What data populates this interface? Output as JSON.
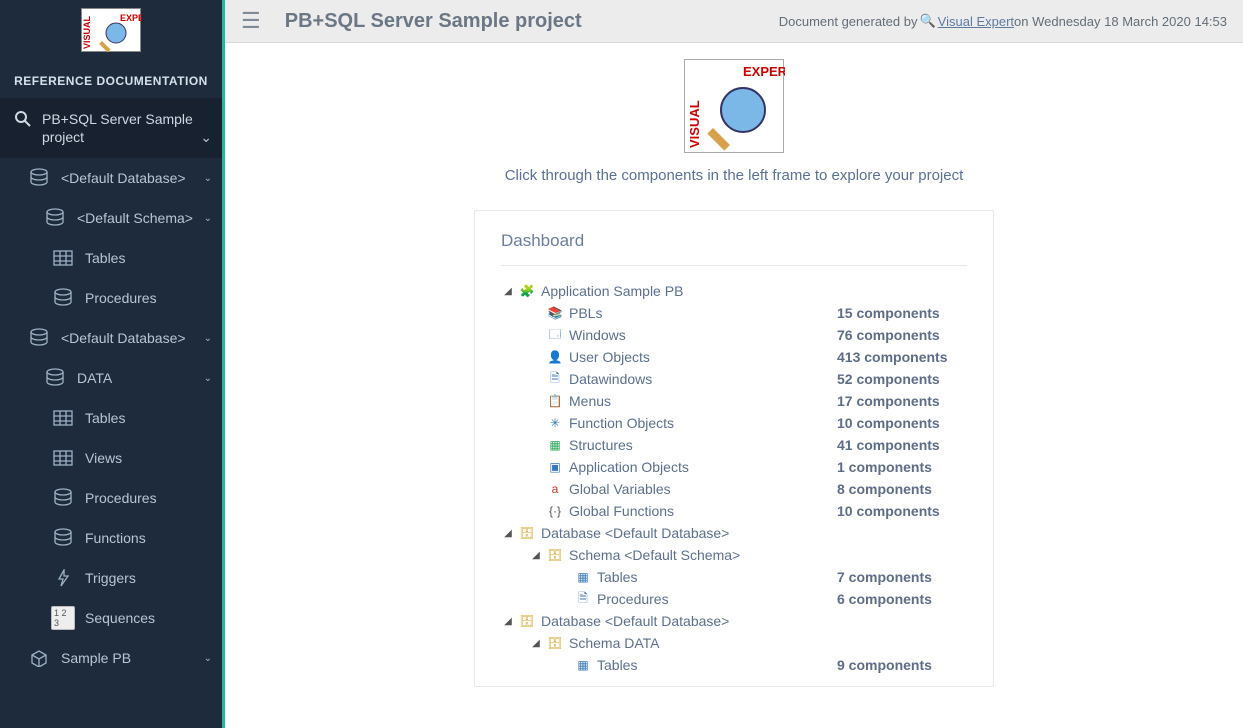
{
  "sidebar": {
    "title": "REFERENCE DOCUMENTATION",
    "project_label": "PB+SQL Server Sample project",
    "items": [
      {
        "label": "<Default Database>",
        "indent": 1,
        "icon": "db",
        "expandable": true
      },
      {
        "label": "<Default Schema>",
        "indent": 2,
        "icon": "db",
        "expandable": true
      },
      {
        "label": "Tables",
        "indent": 3,
        "icon": "table",
        "expandable": false
      },
      {
        "label": "Procedures",
        "indent": 3,
        "icon": "db",
        "expandable": false
      },
      {
        "label": "<Default Database>",
        "indent": 1,
        "icon": "db",
        "expandable": true
      },
      {
        "label": "DATA",
        "indent": 2,
        "icon": "db",
        "expandable": true
      },
      {
        "label": "Tables",
        "indent": 3,
        "icon": "table",
        "expandable": false
      },
      {
        "label": "Views",
        "indent": 3,
        "icon": "views",
        "expandable": false
      },
      {
        "label": "Procedures",
        "indent": 3,
        "icon": "db",
        "expandable": false
      },
      {
        "label": "Functions",
        "indent": 3,
        "icon": "fn",
        "expandable": false
      },
      {
        "label": "Triggers",
        "indent": 3,
        "icon": "trigger",
        "expandable": false
      },
      {
        "label": "Sequences",
        "indent": 3,
        "icon": "seq",
        "expandable": false
      },
      {
        "label": "Sample PB",
        "indent": 1,
        "icon": "pkg",
        "expandable": true
      }
    ]
  },
  "header": {
    "page_title": "PB+SQL Server Sample project",
    "generated_prefix": "Document generated by ",
    "generated_link": "Visual Expert",
    "generated_suffix": " on Wednesday 18 March 2020 14:53"
  },
  "content": {
    "intro": "Click through the components in the left frame to explore your project",
    "dashboard_title": "Dashboard"
  },
  "tree": [
    {
      "level": 0,
      "twisty": "▾",
      "icon": "app",
      "name": "Application Sample PB",
      "count": ""
    },
    {
      "level": 1,
      "twisty": "",
      "icon": "pbl",
      "name": "PBLs",
      "count": "15 components"
    },
    {
      "level": 1,
      "twisty": "",
      "icon": "win",
      "name": "Windows",
      "count": "76 components"
    },
    {
      "level": 1,
      "twisty": "",
      "icon": "usr",
      "name": "User Objects",
      "count": "413 components"
    },
    {
      "level": 1,
      "twisty": "",
      "icon": "dw",
      "name": "Datawindows",
      "count": "52 components"
    },
    {
      "level": 1,
      "twisty": "",
      "icon": "menu",
      "name": "Menus",
      "count": "17 components"
    },
    {
      "level": 1,
      "twisty": "",
      "icon": "func",
      "name": "Function Objects",
      "count": "10 components"
    },
    {
      "level": 1,
      "twisty": "",
      "icon": "struct",
      "name": "Structures",
      "count": "41 components"
    },
    {
      "level": 1,
      "twisty": "",
      "icon": "appobj",
      "name": "Application Objects",
      "count": "1 components"
    },
    {
      "level": 1,
      "twisty": "",
      "icon": "gvar",
      "name": "Global Variables",
      "count": "8 components"
    },
    {
      "level": 1,
      "twisty": "",
      "icon": "gfun",
      "name": "Global Functions",
      "count": "10 components"
    },
    {
      "level": 0,
      "twisty": "▾",
      "icon": "dbcube",
      "name": "Database <Default Database>",
      "count": ""
    },
    {
      "level": 1,
      "twisty": "▾",
      "icon": "dbcube",
      "name": "Schema <Default Schema>",
      "count": ""
    },
    {
      "level": 2,
      "twisty": "",
      "icon": "tbl",
      "name": "Tables",
      "count": "7 components"
    },
    {
      "level": 2,
      "twisty": "",
      "icon": "proc",
      "name": "Procedures",
      "count": "6 components"
    },
    {
      "level": 0,
      "twisty": "▾",
      "icon": "dbcube",
      "name": "Database <Default Database>",
      "count": ""
    },
    {
      "level": 1,
      "twisty": "▾",
      "icon": "dbcube",
      "name": "Schema DATA",
      "count": ""
    },
    {
      "level": 2,
      "twisty": "",
      "icon": "tbl",
      "name": "Tables",
      "count": "9 components"
    }
  ],
  "icons": {
    "db": "◫",
    "table": "▦",
    "views": "▤",
    "fn": "ƒ",
    "trigger": "⚡",
    "seq": "123",
    "pkg": "📦",
    "app": "🧩",
    "pbl": "📚",
    "win": "🗔",
    "usr": "👤",
    "dw": "🗎",
    "menu": "📋",
    "func": "✳",
    "struct": "▦",
    "appobj": "▣",
    "gvar": "a",
    "gfun": "{·}",
    "dbcube": "🗄",
    "tbl": "▦",
    "proc": "🗎"
  }
}
